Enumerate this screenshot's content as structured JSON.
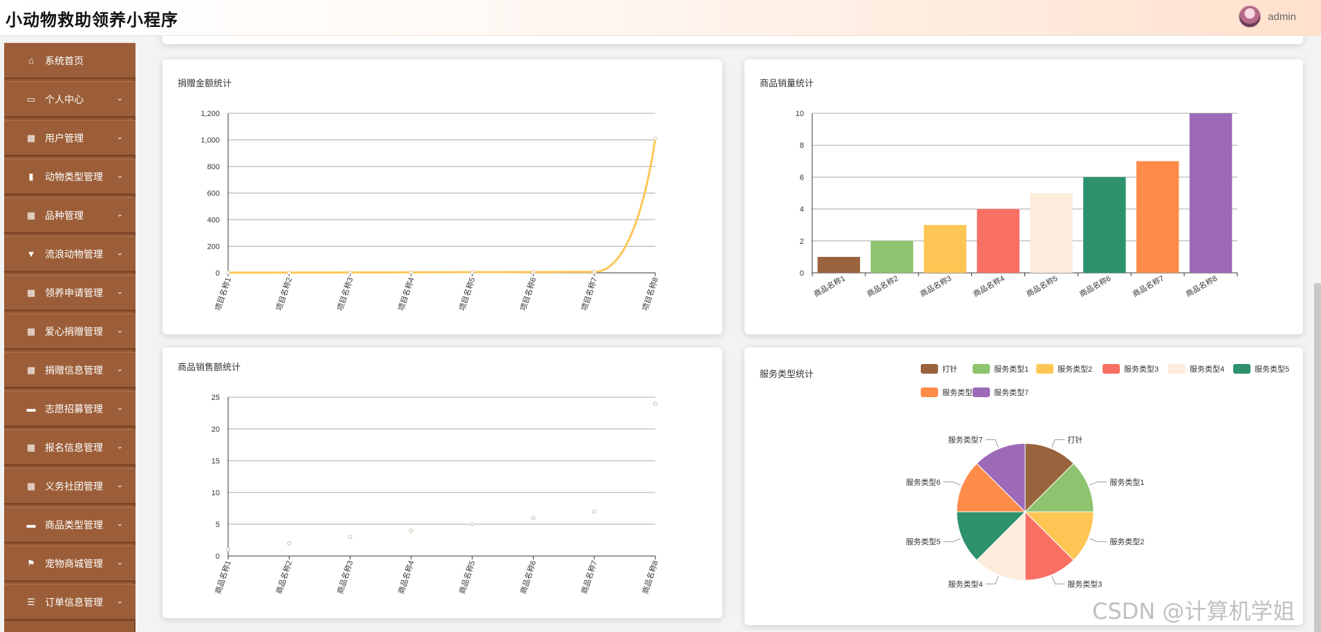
{
  "header": {
    "title": "小动物救助领养小程序",
    "username": "admin"
  },
  "sidebar": {
    "items": [
      {
        "label": "系统首页",
        "icon": "home-icon",
        "has_children": false
      },
      {
        "label": "个人中心",
        "icon": "wallet-icon",
        "has_children": true
      },
      {
        "label": "用户管理",
        "icon": "grid-icon",
        "has_children": true
      },
      {
        "label": "动物类型管理",
        "icon": "bar-chart-icon",
        "has_children": true
      },
      {
        "label": "品种管理",
        "icon": "grid-icon",
        "has_children": true
      },
      {
        "label": "流浪动物管理",
        "icon": "brush-icon",
        "has_children": true
      },
      {
        "label": "领养申请管理",
        "icon": "grid-icon",
        "has_children": true
      },
      {
        "label": "爱心捐赠管理",
        "icon": "grid-icon",
        "has_children": true
      },
      {
        "label": "捐赠信息管理",
        "icon": "table-icon",
        "has_children": true
      },
      {
        "label": "志愿招募管理",
        "icon": "cup-icon",
        "has_children": true
      },
      {
        "label": "报名信息管理",
        "icon": "grid-icon",
        "has_children": true
      },
      {
        "label": "义务社团管理",
        "icon": "grid-icon",
        "has_children": true
      },
      {
        "label": "商品类型管理",
        "icon": "monitor-icon",
        "has_children": true
      },
      {
        "label": "宠物商城管理",
        "icon": "flag-icon",
        "has_children": true
      },
      {
        "label": "订单信息管理",
        "icon": "list-icon",
        "has_children": true
      }
    ]
  },
  "colors": {
    "sidebar_bg": "#9a5c37",
    "palette": [
      "#98633d",
      "#8ec46f",
      "#fdc654",
      "#f86f63",
      "#fdebdb",
      "#2e926d",
      "#ff8b49",
      "#9d6ab7"
    ]
  },
  "charts": {
    "donation": {
      "title": "捐赠金额统计"
    },
    "sales_qty": {
      "title": "商品销量统计"
    },
    "sales_amount": {
      "title": "商品销售额统计"
    },
    "service_type": {
      "title": "服务类型统计"
    }
  },
  "chart_data": [
    {
      "id": "donation",
      "type": "line",
      "smooth": true,
      "title": "捐赠金额统计",
      "categories": [
        "项目名称1",
        "项目名称2",
        "项目名称3",
        "项目名称4",
        "项目名称5",
        "项目名称6",
        "项目名称7",
        "项目名称8"
      ],
      "values": [
        1,
        2,
        3,
        4,
        5,
        6,
        7,
        1010
      ],
      "ylim": [
        0,
        1200
      ],
      "yticks": [
        "0",
        "200",
        "400",
        "600",
        "800",
        "1,000",
        "1,200"
      ],
      "grid": true,
      "color": "#fdc654"
    },
    {
      "id": "sales_qty",
      "type": "bar",
      "title": "商品销量统计",
      "categories": [
        "商品名称1",
        "商品名称2",
        "商品名称3",
        "商品名称4",
        "商品名称5",
        "商品名称6",
        "商品名称7",
        "商品名称8"
      ],
      "values": [
        1,
        2,
        3,
        4,
        5,
        6,
        7,
        10
      ],
      "ylim": [
        0,
        10
      ],
      "yticks": [
        "0",
        "2",
        "4",
        "6",
        "8",
        "10"
      ],
      "grid": true
    },
    {
      "id": "sales_amount",
      "type": "scatter",
      "title": "商品销售额统计",
      "categories": [
        "商品名称1",
        "商品名称2",
        "商品名称3",
        "商品名称4",
        "商品名称5",
        "商品名称6",
        "商品名称7",
        "商品名称8"
      ],
      "values": [
        1,
        2,
        3,
        4,
        5,
        6,
        7,
        24
      ],
      "ylim": [
        0,
        25
      ],
      "yticks": [
        "0",
        "5",
        "10",
        "15",
        "20",
        "25"
      ],
      "grid": true
    },
    {
      "id": "service_type",
      "type": "pie",
      "title": "服务类型统计",
      "labels": [
        "打针",
        "服务类型1",
        "服务类型2",
        "服务类型3",
        "服务类型4",
        "服务类型5",
        "服务类型6",
        "服务类型7"
      ],
      "values": [
        1,
        1,
        1,
        1,
        1,
        1,
        1,
        1
      ],
      "legend": "top-right"
    }
  ],
  "watermark": "CSDN @计算机学姐"
}
